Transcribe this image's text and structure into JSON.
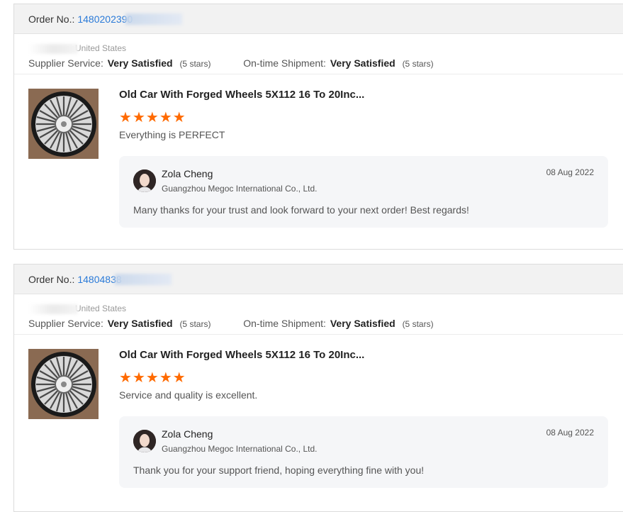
{
  "orders": [
    {
      "order_label": "Order No.:",
      "order_number": "1480202390",
      "country": "United States",
      "supplier_label": "Supplier Service:",
      "supplier_value": "Very Satisfied",
      "supplier_stars": "(5 stars)",
      "shipment_label": "On-time Shipment:",
      "shipment_value": "Very Satisfied",
      "shipment_stars": "(5 stars)",
      "product_title": "Old Car With Forged Wheels 5X112 16 To 20Inc...",
      "rating": 5,
      "review": "Everything is PERFECT",
      "reply": {
        "name": "Zola Cheng",
        "company": "Guangzhou Megoc International Co., Ltd.",
        "date": "08 Aug 2022",
        "text": "Many thanks for your trust and look forward to your next order! Best regards!"
      }
    },
    {
      "order_label": "Order No.:",
      "order_number": "14804838",
      "country": "United States",
      "supplier_label": "Supplier Service:",
      "supplier_value": "Very Satisfied",
      "supplier_stars": "(5 stars)",
      "shipment_label": "On-time Shipment:",
      "shipment_value": "Very Satisfied",
      "shipment_stars": "(5 stars)",
      "product_title": "Old Car With Forged Wheels 5X112 16 To 20Inc...",
      "rating": 5,
      "review": "Service and quality is excellent.",
      "reply": {
        "name": "Zola Cheng",
        "company": "Guangzhou Megoc International Co., Ltd.",
        "date": "08 Aug 2022",
        "text": "Thank you for your support friend, hoping everything fine with you!"
      }
    }
  ],
  "colors": {
    "star": "#ff6a00",
    "order_link": "#2a7ad8",
    "header_bg": "#f2f2f2",
    "reply_bg": "#f5f6f8"
  },
  "icons": {
    "star": "star-icon",
    "wheel": "wheel-thumbnail",
    "avatar": "supplier-avatar"
  }
}
